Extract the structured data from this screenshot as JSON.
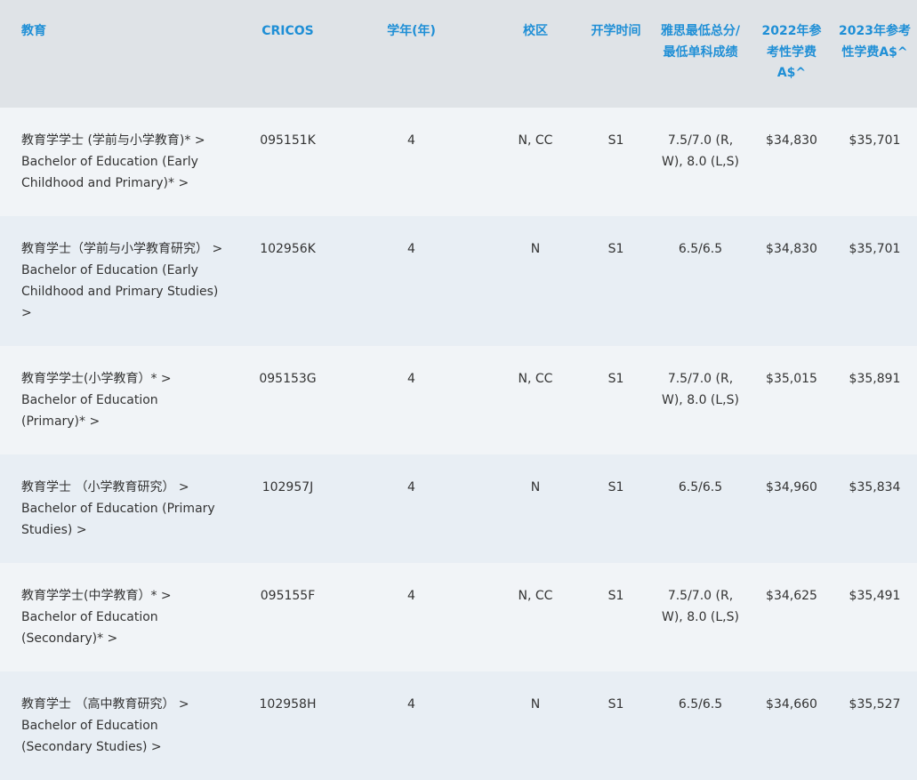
{
  "headers": {
    "course": "教育",
    "cricos": "CRICOS",
    "years": "学年(年)",
    "campus": "校区",
    "intake": "开学时间",
    "ielts": "雅思最低总分/最低单科成绩",
    "fee2022": "2022年参考性学费A$^",
    "fee2023": "2023年参考性学费A$^"
  },
  "rows": [
    {
      "zh": "教育学学士 (学前与小学教育)* >",
      "en": "Bachelor of Education (Early Childhood and Primary)* >",
      "cricos": "095151K",
      "years": "4",
      "campus": "N, CC",
      "intake": "S1",
      "ielts": "7.5/7.0 (R, W), 8.0 (L,S)",
      "fee2022": "$34,830",
      "fee2023": "$35,701"
    },
    {
      "zh": "教育学士（学前与小学教育研究） >",
      "en": "Bachelor of Education (Early Childhood and Primary Studies) >",
      "cricos": "102956K",
      "years": "4",
      "campus": "N",
      "intake": "S1",
      "ielts": "6.5/6.5",
      "fee2022": "$34,830",
      "fee2023": "$35,701"
    },
    {
      "zh": "教育学学士(小学教育）* >",
      "en": "Bachelor of Education (Primary)* >",
      "cricos": "095153G",
      "years": "4",
      "campus": "N, CC",
      "intake": "S1",
      "ielts": "7.5/7.0 (R, W), 8.0 (L,S)",
      "fee2022": "$35,015",
      "fee2023": "$35,891"
    },
    {
      "zh": "教育学士 （小学教育研究） >",
      "en": "Bachelor of Education (Primary Studies) >",
      "cricos": "102957J",
      "years": "4",
      "campus": "N",
      "intake": "S1",
      "ielts": "6.5/6.5",
      "fee2022": "$34,960",
      "fee2023": "$35,834"
    },
    {
      "zh": "教育学学士(中学教育）* >",
      "en": "Bachelor of Education (Secondary)* >",
      "cricos": "095155F",
      "years": "4",
      "campus": "N, CC",
      "intake": "S1",
      "ielts": "7.5/7.0 (R, W), 8.0 (L,S)",
      "fee2022": "$34,625",
      "fee2023": "$35,491"
    },
    {
      "zh": "教育学士 （高中教育研究） >",
      "en": "Bachelor of Education (Secondary Studies) >",
      "cricos": "102958H",
      "years": "4",
      "campus": "N",
      "intake": "S1",
      "ielts": "6.5/6.5",
      "fee2022": "$34,660",
      "fee2023": "$35,527"
    }
  ]
}
